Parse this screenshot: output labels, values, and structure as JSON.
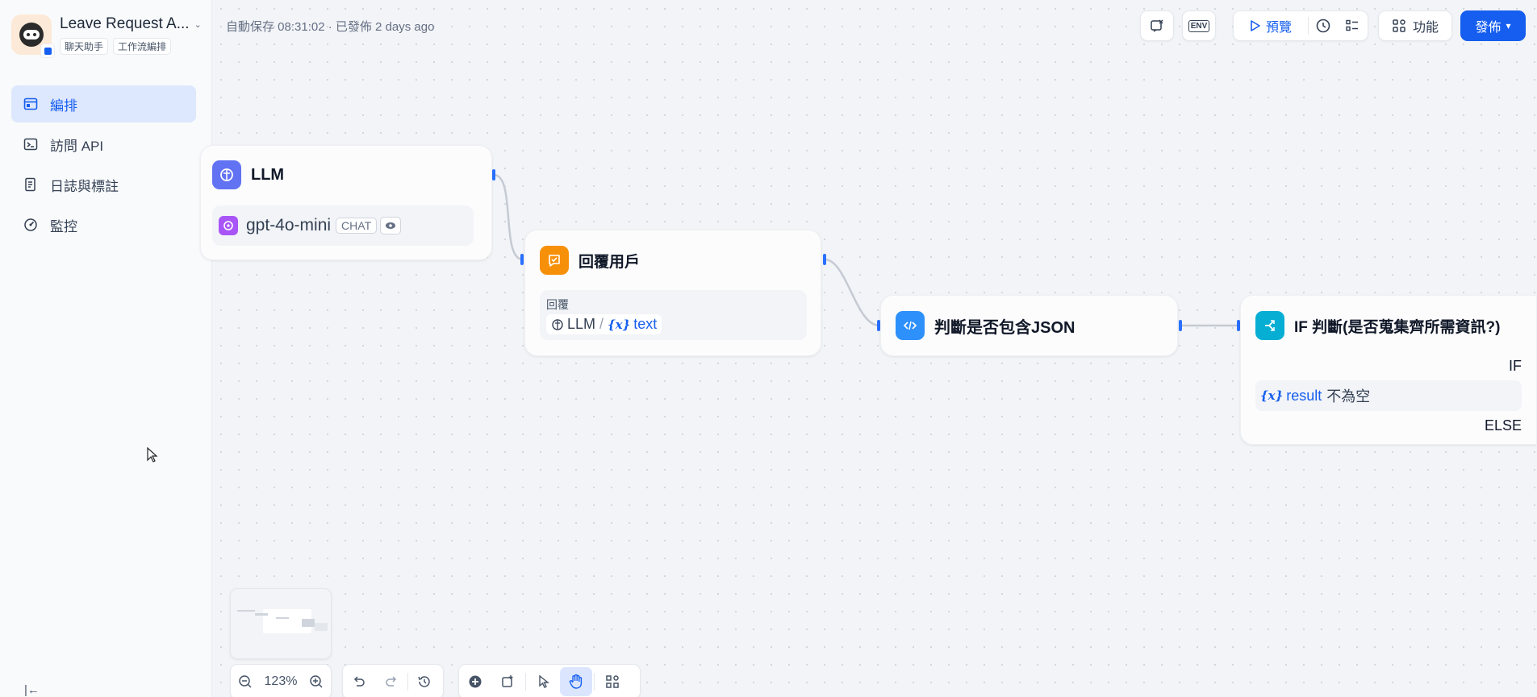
{
  "app": {
    "title": "Leave Request A...",
    "tags": [
      "聊天助手",
      "工作流編排"
    ]
  },
  "nav": [
    {
      "label": "編排",
      "icon": "layout-icon",
      "active": true
    },
    {
      "label": "訪問 API",
      "icon": "terminal-icon",
      "active": false
    },
    {
      "label": "日誌與標註",
      "icon": "file-list-icon",
      "active": false
    },
    {
      "label": "監控",
      "icon": "dashboard-icon",
      "active": false
    }
  ],
  "autosave": "自動保存 08:31:02 · 已發佈 2 days ago",
  "toolbar": {
    "preview_label": "預覽",
    "features_label": "功能",
    "publish_label": "發佈",
    "env_label": "ENV"
  },
  "nodes": {
    "llm": {
      "title": "LLM",
      "model": "gpt-4o-mini",
      "mode": "CHAT"
    },
    "reply": {
      "title": "回覆用戶",
      "field_label": "回覆",
      "var_node": "LLM",
      "var_sep": "/",
      "var_icon": "{x}",
      "var_name": "text"
    },
    "code": {
      "title": "判斷是否包含JSON"
    },
    "ifelse": {
      "title": "IF 判斷(是否蒐集齊所需資訊?)",
      "if_label": "IF",
      "cond_var": "result",
      "cond_op": "不為空",
      "else_label": "ELSE",
      "var_icon": "{x}"
    }
  },
  "zoom": "123%",
  "colors": {
    "accent": "#155eef",
    "llm": "#6172f3",
    "reply": "#f79009",
    "code": "#2e90fa",
    "ifelse": "#06aed4"
  }
}
